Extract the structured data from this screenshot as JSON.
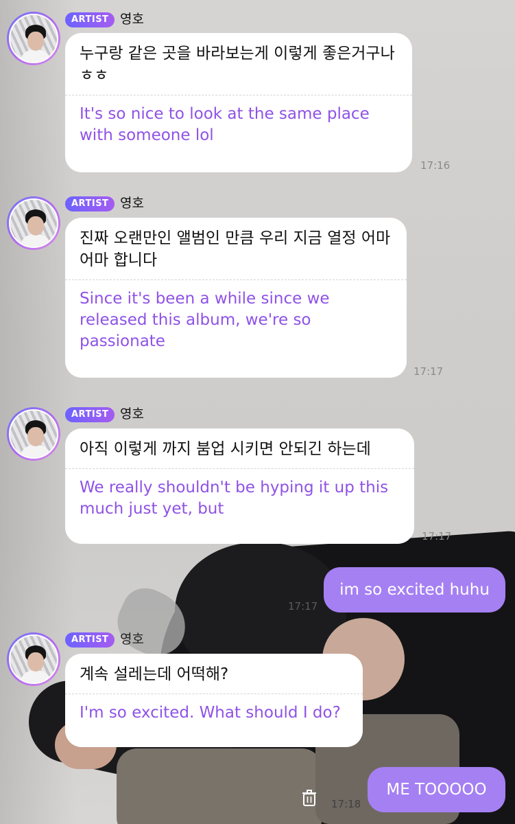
{
  "artist_badge": "ARTIST",
  "artist_name": "영호",
  "messages": [
    {
      "korean": "누구랑 같은 곳을 바라보는게 이렇게 좋은거구나 ㅎㅎ",
      "english": "It's so nice to look at the same place with someone lol",
      "time": "17:16"
    },
    {
      "korean": "진짜 오랜만인 앨범인 만큼 우리 지금 열정 어마어마 합니다",
      "english": "Since it's been a while since we released this album, we're so passionate",
      "time": "17:17"
    },
    {
      "korean": "아직 이렇게 까지 붐업 시키면 안되긴 하는데",
      "english": "We really shouldn't be hyping it up this much just yet, but",
      "time": "17:17"
    },
    {
      "korean": "계속 설레는데 어떡해?",
      "english": "I'm so excited. What should I do?",
      "time": ""
    }
  ],
  "my_messages": [
    {
      "text": "im so excited huhu",
      "time": "17:17"
    },
    {
      "text": "ME TOOOOO",
      "time": "17:18"
    }
  ],
  "icons": {
    "delete": "trash-icon"
  },
  "colors": {
    "badge": "#a55cf0",
    "translation": "#8f52e6",
    "my_bubble": "#a580f3"
  }
}
